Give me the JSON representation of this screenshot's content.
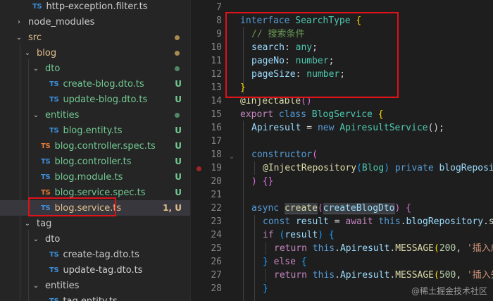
{
  "explorer": {
    "rows": [
      {
        "label": "http-exception.filter.ts",
        "kind": "file",
        "color": "plain"
      },
      {
        "label": "node_modules",
        "kind": "folder",
        "chevron": "›",
        "color": "plain"
      },
      {
        "label": "src",
        "kind": "folder",
        "chevron": "⌄",
        "color": "yellow",
        "mark": "dot-yellow"
      },
      {
        "label": "blog",
        "kind": "folder",
        "chevron": "⌄",
        "color": "yellow",
        "mark": "dot-yellow"
      },
      {
        "label": "dto",
        "kind": "folder",
        "chevron": "⌄",
        "color": "green",
        "mark": "dot-green"
      },
      {
        "label": "create-blog.dto.ts",
        "kind": "file",
        "color": "green",
        "badge": "U"
      },
      {
        "label": "update-blog.dto.ts",
        "kind": "file",
        "color": "green",
        "badge": "U"
      },
      {
        "label": "entities",
        "kind": "folder",
        "chevron": "⌄",
        "color": "green",
        "mark": "dot-green"
      },
      {
        "label": "blog.entity.ts",
        "kind": "file",
        "color": "green",
        "badge": "U"
      },
      {
        "label": "blog.controller.spec.ts",
        "kind": "spec",
        "color": "green",
        "badge": "U"
      },
      {
        "label": "blog.controller.ts",
        "kind": "file",
        "color": "green",
        "badge": "U"
      },
      {
        "label": "blog.module.ts",
        "kind": "file",
        "color": "green",
        "badge": "U"
      },
      {
        "label": "blog.service.spec.ts",
        "kind": "spec",
        "color": "green",
        "badge": "U"
      },
      {
        "label": "blog.service.ts",
        "kind": "file",
        "color": "yellow",
        "badge": "1, U",
        "selected": true
      },
      {
        "label": "tag",
        "kind": "folder",
        "chevron": "⌄",
        "color": "plain"
      },
      {
        "label": "dto",
        "kind": "folder",
        "chevron": "⌄",
        "color": "plain"
      },
      {
        "label": "create-tag.dto.ts",
        "kind": "file",
        "color": "plain"
      },
      {
        "label": "update-tag.dto.ts",
        "kind": "file",
        "color": "plain"
      },
      {
        "label": "entities",
        "kind": "folder",
        "chevron": "⌄",
        "color": "plain"
      },
      {
        "label": "tag.entity.ts",
        "kind": "file",
        "color": "plain"
      }
    ],
    "ts_icon_text": "TS"
  },
  "editor": {
    "line_numbers": [
      "7",
      "8",
      "9",
      "10",
      "11",
      "12",
      "13",
      "14",
      "15",
      "16",
      "17",
      "18",
      "19",
      "20",
      "21",
      "22",
      "23",
      "24",
      "25",
      "26",
      "27",
      "28"
    ],
    "line8": {
      "kw": "interface",
      "name": "SearchType",
      "brace": "{"
    },
    "line9": {
      "comment": "// 搜索条件"
    },
    "line10": {
      "prop": "search",
      "type": "any"
    },
    "line11": {
      "prop": "pageNo",
      "type": "number"
    },
    "line12": {
      "prop": "pageSize",
      "type": "number"
    },
    "line13": {
      "brace": "}"
    },
    "line14": {
      "decorator": "@Injectable",
      "paren": "()"
    },
    "line15": {
      "kw1": "export",
      "kw2": "class",
      "name": "BlogService",
      "brace": "{"
    },
    "line16": {
      "prop": "Apiresult",
      "op": " = ",
      "kw": "new",
      "name": "ApiresultService",
      "tail": "();"
    },
    "line18": {
      "fn": "constructor",
      "paren": "("
    },
    "line19": {
      "decorator": "@InjectRepository",
      "arg": "Blog",
      "kw": "private",
      "prop": "blogReposit"
    },
    "line20": {
      "text": ") {}"
    },
    "line22": {
      "kw": "async",
      "fn": "create",
      "param": "createBlogDto",
      "tail": ") {"
    },
    "line23": {
      "kw1": "const",
      "var": "result",
      "kw2": "await",
      "kw3": "this",
      "prop": "blogRepository",
      "tail": ".sa"
    },
    "line24": {
      "kw": "if",
      "var": "result",
      "tail": ") {"
    },
    "line25": {
      "kw1": "return",
      "kw2": "this",
      "obj": "Apiresult",
      "fn": "MESSAGE",
      "num": "200",
      "str": "'插入成"
    },
    "line26": {
      "text1": "} ",
      "kw": "else",
      "text2": " {"
    },
    "line27": {
      "kw1": "return",
      "kw2": "this",
      "obj": "Apiresult",
      "fn": "MESSAGE",
      "num": "500",
      "str": "'插入失"
    },
    "line28": {
      "text": "}"
    }
  },
  "watermark": "@稀土掘金技术社区"
}
